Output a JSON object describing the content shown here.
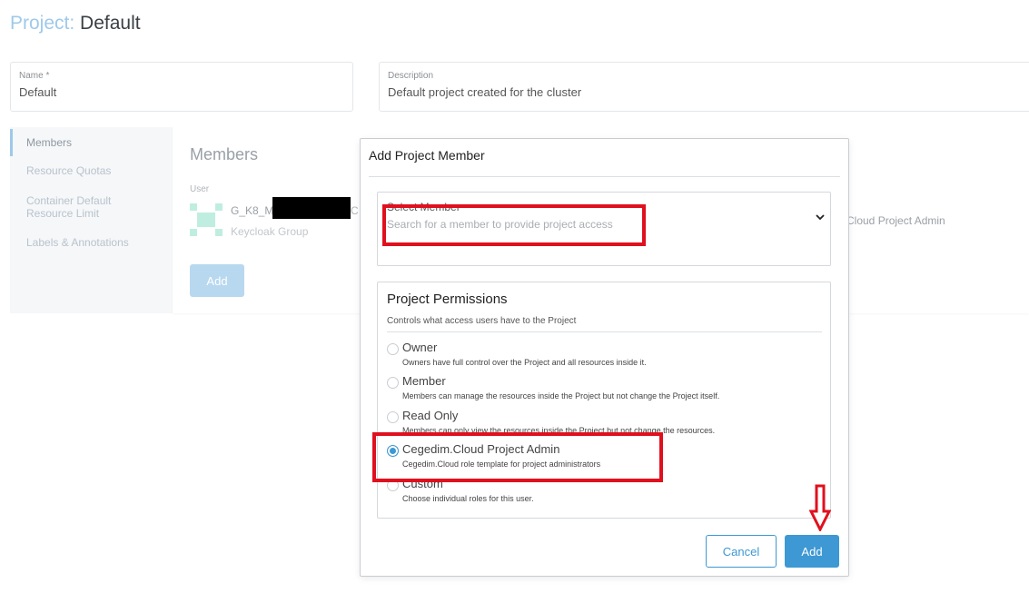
{
  "page": {
    "title_prefix": "Project:",
    "title_value": "Default"
  },
  "fields": {
    "name_label": "Name *",
    "name_value": "Default",
    "description_label": "Description",
    "description_value": "Default project created for the cluster"
  },
  "sidebar": {
    "items": [
      {
        "label": "Members"
      },
      {
        "label": "Resource Quotas"
      },
      {
        "label": "Container Default Resource Limit"
      },
      {
        "label": "Labels & Annotations"
      }
    ]
  },
  "members": {
    "title": "Members",
    "user_column": "User",
    "user_name": "G_K8_M",
    "user_name_tail": "C",
    "user_type": "Keycloak Group",
    "role": "Cloud Project Admin",
    "add_label": "Add"
  },
  "modal": {
    "title": "Add Project Member",
    "select_label": "Select Member",
    "select_placeholder": "Search for a member to provide project access",
    "permissions_title": "Project Permissions",
    "permissions_subtitle": "Controls what access users have to the Project",
    "options": [
      {
        "label": "Owner",
        "description": "Owners have full control over the Project and all resources inside it.",
        "checked": false
      },
      {
        "label": "Member",
        "description": "Members can manage the resources inside the Project but not change the Project itself.",
        "checked": false
      },
      {
        "label": "Read Only",
        "description": "Members can only view the resources inside the Project but not change the resources.",
        "checked": false
      },
      {
        "label": "Cegedim.Cloud Project Admin",
        "description": "Cegedim.Cloud role template for project administrators",
        "checked": true
      },
      {
        "label": "Custom",
        "description": "Choose individual roles for this user.",
        "checked": false
      }
    ],
    "cancel_label": "Cancel",
    "add_label": "Add"
  },
  "colors": {
    "accent": "#3d98d3",
    "annotation": "#e0101e"
  },
  "icons": {
    "chevron": "chevron-down-icon",
    "annotation_arrow": "arrow-down-icon"
  }
}
